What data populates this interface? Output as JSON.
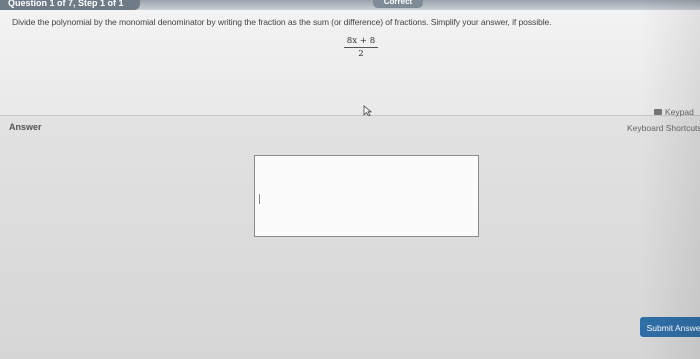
{
  "header": {
    "question_tab": "Question 1 of 7, Step 1 of 1",
    "status": "Correct"
  },
  "question": {
    "instructions": "Divide the polynomial by the monomial denominator by writing the fraction as the sum (or difference) of fractions. Simplify your answer, if possible.",
    "numerator": "8x + 8",
    "denominator": "2"
  },
  "answer": {
    "label": "Answer",
    "keypad_label": "Keypad",
    "shortcuts_label": "Keyboard Shortcuts",
    "input_value": ""
  },
  "footer": {
    "submit_label": "Submit Answer"
  },
  "colors": {
    "accent": "#2f6fa8",
    "panel": "#ececec",
    "background": "#d9d9d9"
  }
}
